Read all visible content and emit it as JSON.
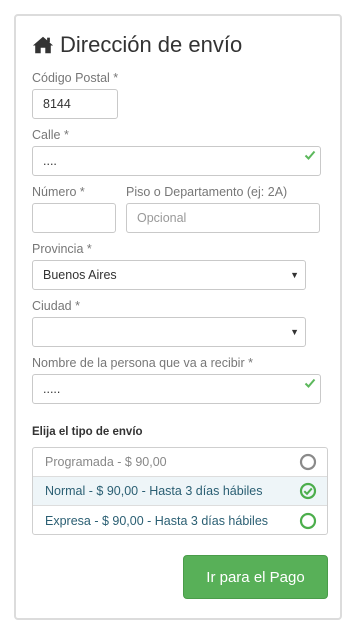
{
  "title": "Dirección de envío",
  "colors": {
    "success": "#5cb85c",
    "selected_bg": "#eef5f8",
    "selected_text": "#2b5f73",
    "button": "#58b058"
  },
  "form": {
    "postal_code": {
      "label": "Código Postal *",
      "value": "8144"
    },
    "street": {
      "label": "Calle *",
      "value": "...."
    },
    "number": {
      "label": "Número *",
      "value": ""
    },
    "floor": {
      "label": "Piso o Departamento (ej: 2A)",
      "placeholder": "Opcional",
      "value": ""
    },
    "province": {
      "label": "Provincia *",
      "selected": "Buenos Aires"
    },
    "city": {
      "label": "Ciudad *",
      "selected": ""
    },
    "recipient": {
      "label": "Nombre de la persona que va a recibir *",
      "value": "....."
    }
  },
  "shipping": {
    "title": "Elija el tipo de envío",
    "options": [
      {
        "label": "Programada - $ 90,00",
        "state": "disabled"
      },
      {
        "label": "Normal - $ 90,00 - Hasta 3 días hábiles",
        "state": "selected"
      },
      {
        "label": "Expresa - $ 90,00 - Hasta 3 días hábiles",
        "state": "available"
      }
    ]
  },
  "pay_button": "Ir para el Pago",
  "icons": {
    "title": "home-icon",
    "valid": "check-icon",
    "select": "caret-down-icon",
    "radio": "radio-icon"
  }
}
